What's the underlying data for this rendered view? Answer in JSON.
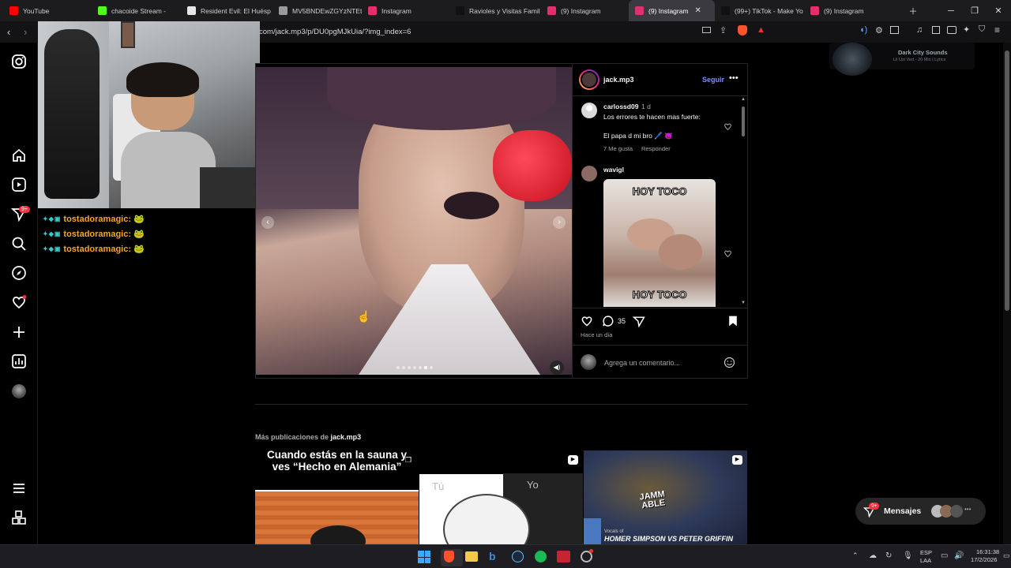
{
  "tabs": [
    {
      "label": "YouTube",
      "color": "#ff0000"
    },
    {
      "label": "chacoide Stream -",
      "color": "#53fc18"
    },
    {
      "label": "Resident Evil: El Huésp",
      "color": "#e6e6e6"
    },
    {
      "label": "MV5BNDEwZGYzNTEt",
      "color": "#9a9a9a"
    },
    {
      "label": "Instagram",
      "color": "#e1306c"
    },
    {
      "label": "Ravioles y Visitas Famil",
      "color": "#111111"
    },
    {
      "label": "(9) Instagram",
      "color": "#e1306c"
    },
    {
      "label": "(9) Instagram",
      "color": "#e1306c",
      "active": true
    },
    {
      "label": "(99+) TikTok - Make Yo",
      "color": "#111111"
    },
    {
      "label": "(9) Instagram",
      "color": "#e1306c"
    }
  ],
  "url": "com/jack.mp3/p/DU0pgMJkUia/?img_index=6",
  "media_widget": {
    "title": "Dark City Sounds",
    "subtitle": "Lil Uzi Vert - 20 Min | Lyrics"
  },
  "chat": [
    {
      "user": "tostadoramagic:"
    },
    {
      "user": "tostadoramagic:"
    },
    {
      "user": "tostadoramagic:"
    }
  ],
  "post": {
    "username": "jack.mp3",
    "follow": "Seguir",
    "comments": [
      {
        "user": "carlossd09",
        "time": "1 d",
        "line1": "Los errores te hacen mas fuerte:",
        "line2": "El papa d mi bro 🖊️ 😈",
        "likes": "7 Me gusta",
        "reply": "Responder"
      },
      {
        "user": "wavigl",
        "meme_top": "HOY TOCO",
        "meme_bottom": "HOY TOCO"
      }
    ],
    "comment_count": "35",
    "when": "Hace un día",
    "add_comment": "Agrega un comentario..."
  },
  "more": {
    "prefix": "Más publicaciones de",
    "user": "jack.mp3"
  },
  "thumbs": [
    {
      "text": "Cuando estás en la sauna y ves “Hecho en Alemania”"
    },
    {
      "label_a": "Tú",
      "label_b": "Yo"
    },
    {
      "logo": "JAMM ABLE",
      "caption_a": "Vocals of",
      "caption_b": "HOMER SIMPSON VS PETER GRIFFIN"
    }
  ],
  "messages": {
    "label": "Mensajes",
    "badge": "9+"
  },
  "side_badge": "9+",
  "taskbar": {
    "lang1": "ESP",
    "lang2": "LAA",
    "time": "16:31:38",
    "date": "17/2/2026"
  }
}
